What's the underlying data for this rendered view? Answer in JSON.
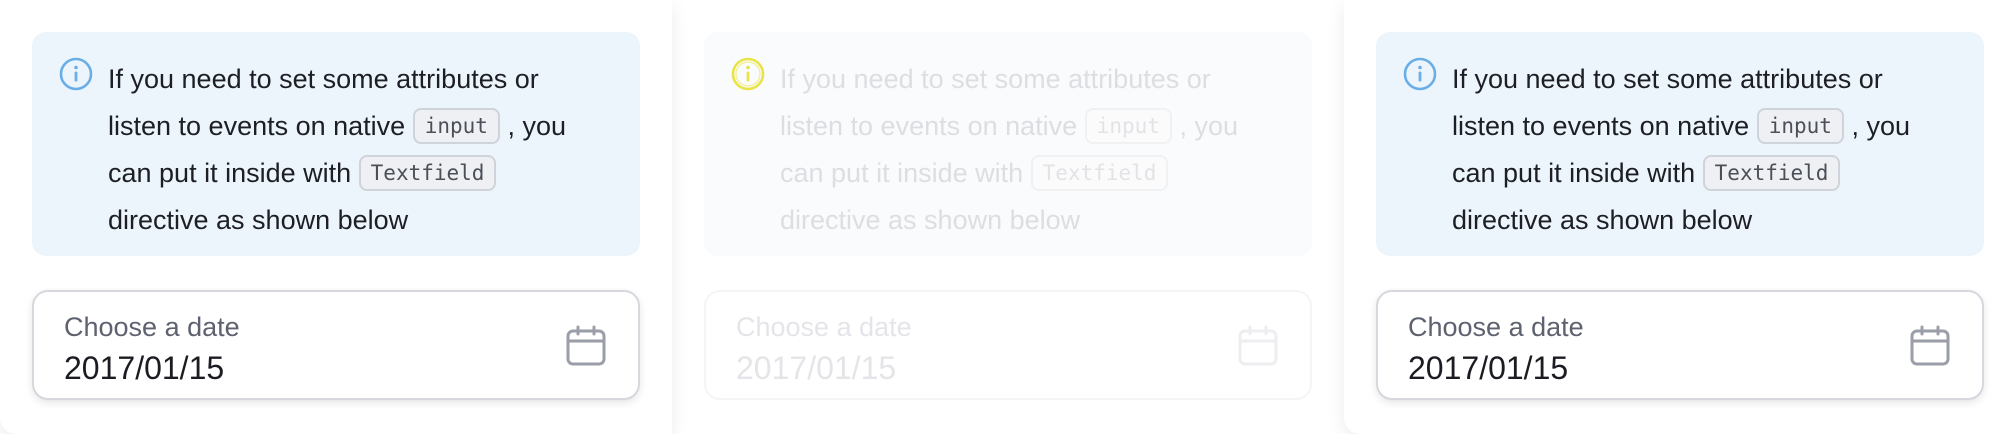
{
  "panels": [
    {
      "state": "default",
      "info": {
        "icon": "info-icon",
        "text_before_input": "If you need to set some attributes or listen to events on native",
        "code_input": "input",
        "text_before_textfield": ", you can put it inside with",
        "code_textfield": "Textfield",
        "text_after": "directive as shown below"
      },
      "date_field": {
        "label": "Choose a date",
        "value": "2017/01/15",
        "icon": "calendar-icon"
      }
    },
    {
      "state": "faded",
      "info": {
        "icon": "info-icon",
        "text_before_input": "If you need to set some attributes or listen to events on native",
        "code_input": "input",
        "text_before_textfield": ", you can put it inside with",
        "code_textfield": "Textfield",
        "text_after": "directive as shown below"
      },
      "date_field": {
        "label": "Choose a date",
        "value": "2017/01/15",
        "icon": "calendar-icon"
      }
    },
    {
      "state": "default",
      "info": {
        "icon": "info-icon",
        "text_before_input": "If you need to set some attributes or listen to events on native",
        "code_input": "input",
        "text_before_textfield": ", you can put it inside with",
        "code_textfield": "Textfield",
        "text_after": "directive as shown below"
      },
      "date_field": {
        "label": "Choose a date",
        "value": "2017/01/15",
        "icon": "calendar-icon"
      }
    }
  ],
  "colors": {
    "info_bg": "#ecf4fc",
    "info_icon": "#6aaee8",
    "info_icon_faded": "#e9e34a",
    "text": "#1d1f24",
    "label": "#5e6270",
    "calendar_icon": "#9a9ea8"
  }
}
